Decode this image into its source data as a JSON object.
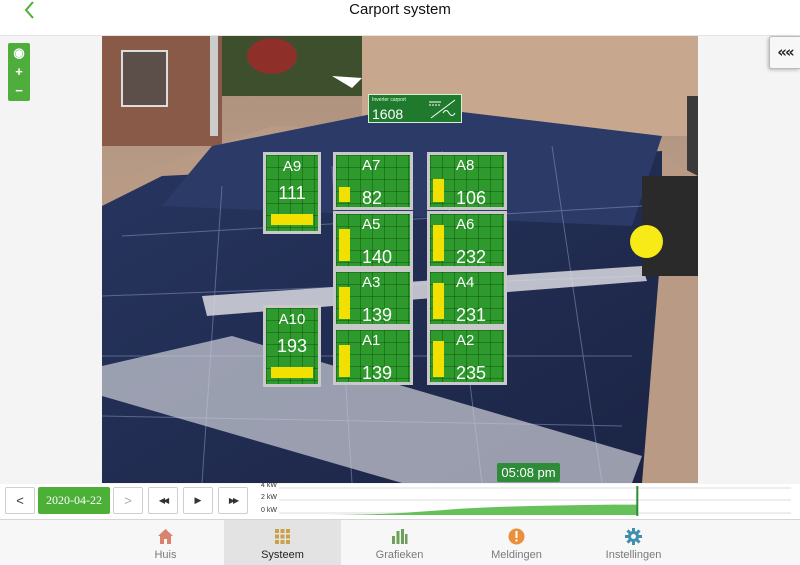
{
  "header": {
    "title": "Carport system"
  },
  "zoom": {
    "locate": "◉",
    "in": "+",
    "out": "−"
  },
  "collapse": {
    "label": "«"
  },
  "inverter": {
    "label": "Inverter carport",
    "value": "1608"
  },
  "panels": [
    {
      "name": "A9",
      "value": "111",
      "level": 0.85
    },
    {
      "name": "A7",
      "value": "82",
      "level": 0.35
    },
    {
      "name": "A8",
      "value": "106",
      "level": 0.55
    },
    {
      "name": "A5",
      "value": "140",
      "level": 0.75
    },
    {
      "name": "A6",
      "value": "232",
      "level": 0.85
    },
    {
      "name": "A3",
      "value": "139",
      "level": 0.75
    },
    {
      "name": "A4",
      "value": "231",
      "level": 0.85
    },
    {
      "name": "A10",
      "value": "193",
      "level": 0.85
    },
    {
      "name": "A1",
      "value": "139",
      "level": 0.75
    },
    {
      "name": "A2",
      "value": "235",
      "level": 0.85
    }
  ],
  "time_badge": "05:08 pm",
  "timebar": {
    "prev": "<",
    "date": "2020-04-22",
    "next": ">",
    "rewind": "◀◀",
    "play": "▶",
    "forward": "▶▶",
    "y_labels": [
      "4 kW",
      "2 kW",
      "0 kW"
    ],
    "production_profile": [
      0,
      0,
      0,
      0,
      0.02,
      0.05,
      0.1,
      0.2,
      0.3,
      0.42,
      0.5,
      0.55,
      0.6,
      0.63,
      0.66,
      0.68,
      0.7,
      0.7,
      0.69,
      0.67,
      0.65,
      0.62,
      0.58,
      0.5,
      0.45
    ],
    "cursor_fraction": 0.71
  },
  "nav": [
    {
      "label": "Huis",
      "icon": "home-icon",
      "color": "#d9826d",
      "active": false
    },
    {
      "label": "Systeem",
      "icon": "grid-icon",
      "color": "#c9a24a",
      "active": true
    },
    {
      "label": "Grafieken",
      "icon": "bar-chart-icon",
      "color": "#6fa05a",
      "active": false
    },
    {
      "label": "Meldingen",
      "icon": "alert-icon",
      "color": "#e8903a",
      "active": false
    },
    {
      "label": "Instellingen",
      "icon": "gear-icon",
      "color": "#3f8fae",
      "active": false
    }
  ]
}
